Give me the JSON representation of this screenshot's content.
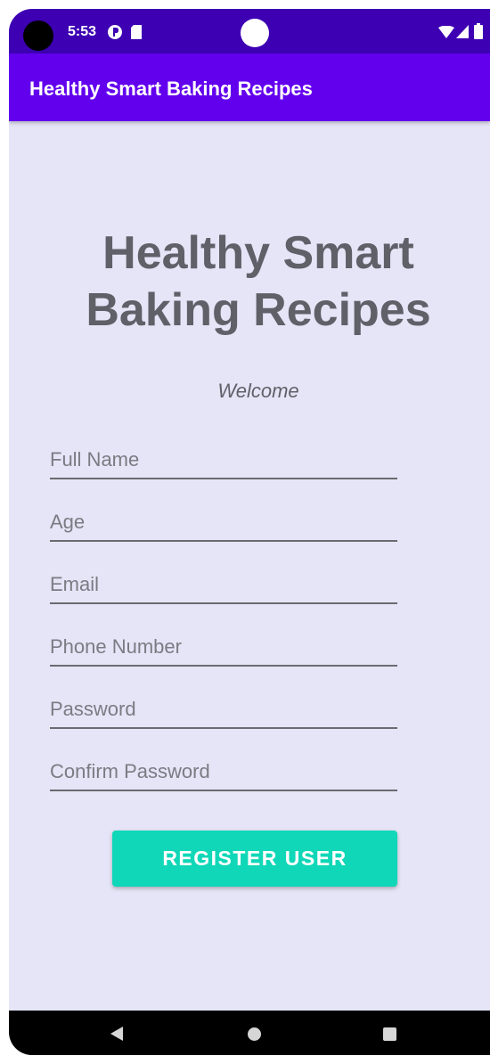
{
  "status_bar": {
    "time": "5:53",
    "icons": [
      "data-saver-icon",
      "sd-card-icon",
      "wifi-icon",
      "signal-icon",
      "battery-icon"
    ]
  },
  "app_bar": {
    "title": "Healthy Smart Baking Recipes"
  },
  "main": {
    "headline_line1": "Healthy Smart",
    "headline_line2": "Baking Recipes",
    "welcome": "Welcome",
    "fields": [
      {
        "placeholder": "Full Name",
        "value": ""
      },
      {
        "placeholder": "Age",
        "value": ""
      },
      {
        "placeholder": "Email",
        "value": ""
      },
      {
        "placeholder": "Phone Number",
        "value": ""
      },
      {
        "placeholder": "Password",
        "value": ""
      },
      {
        "placeholder": "Confirm Password",
        "value": ""
      }
    ],
    "register_label": "REGISTER USER"
  },
  "nav_bar": {
    "buttons": [
      "back-icon",
      "home-icon",
      "recents-icon"
    ]
  },
  "colors": {
    "status_bar": "#3d00b3",
    "app_bar": "#6200ee",
    "background": "#e5e5f7",
    "headline_text": "#5f6068",
    "button": "#10d7b7"
  }
}
